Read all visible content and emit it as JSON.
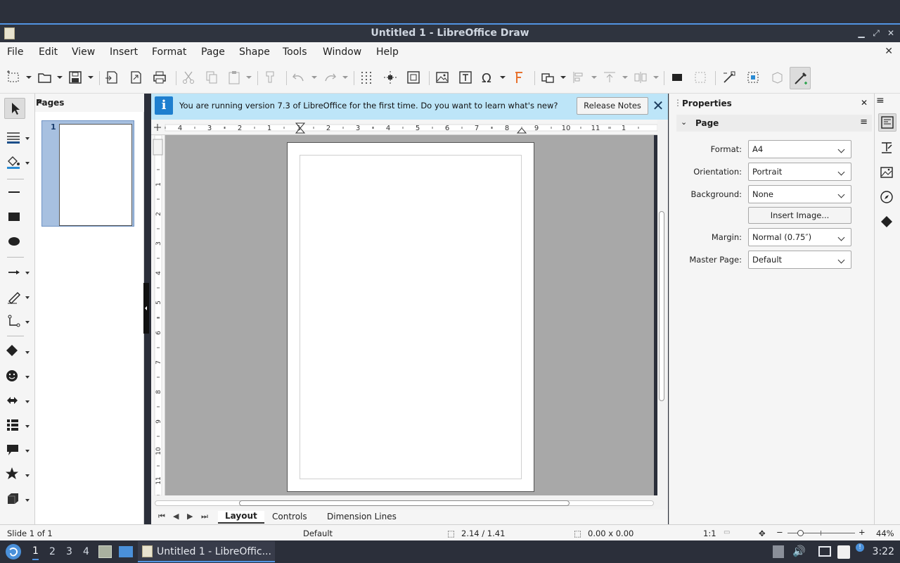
{
  "window": {
    "title": "Untitled 1 - LibreOffice Draw"
  },
  "menu": [
    "File",
    "Edit",
    "View",
    "Insert",
    "Format",
    "Page",
    "Shape",
    "Tools",
    "Window",
    "Help"
  ],
  "pages_pane": {
    "title": "Pages",
    "page_number": "1"
  },
  "infobar": {
    "message": "You are running version 7.3 of LibreOffice for the first time. Do you want to learn what's new?",
    "button": "Release Notes"
  },
  "ruler": {
    "h_labels": [
      "4",
      "3",
      "2",
      "1",
      "1",
      "2",
      "3",
      "4",
      "5",
      "6",
      "7",
      "8",
      "9",
      "10",
      "11",
      "1"
    ],
    "v_labels": [
      "1",
      "2",
      "3",
      "4",
      "5",
      "6",
      "7",
      "8",
      "9",
      "10",
      "11"
    ]
  },
  "tabs": {
    "items": [
      "Layout",
      "Controls",
      "Dimension Lines"
    ],
    "active": "Layout"
  },
  "sidebar": {
    "title": "Properties",
    "section": "Page",
    "format_label": "Format:",
    "format_value": "A4",
    "orientation_label": "Orientation:",
    "orientation_value": "Portrait",
    "background_label": "Background:",
    "background_value": "None",
    "insert_image": "Insert Image...",
    "margin_label": "Margin:",
    "margin_value": "Normal (0.75″)",
    "master_label": "Master Page:",
    "master_value": "Default"
  },
  "status": {
    "slide": "Slide 1 of 1",
    "layout": "Default",
    "position": "2.14 / 1.41",
    "size": "0.00 x 0.00",
    "scale": "1:1",
    "zoom": "44%"
  },
  "taskbar": {
    "workspaces": [
      "1",
      "2",
      "3",
      "4"
    ],
    "active_workspace": "1",
    "task_label": "Untitled 1 - LibreOffic...",
    "clock": "3:22"
  },
  "colors": {
    "accent": "#5294e2",
    "infobar": "#bde5f8",
    "canvas": "#a8a8a8"
  }
}
